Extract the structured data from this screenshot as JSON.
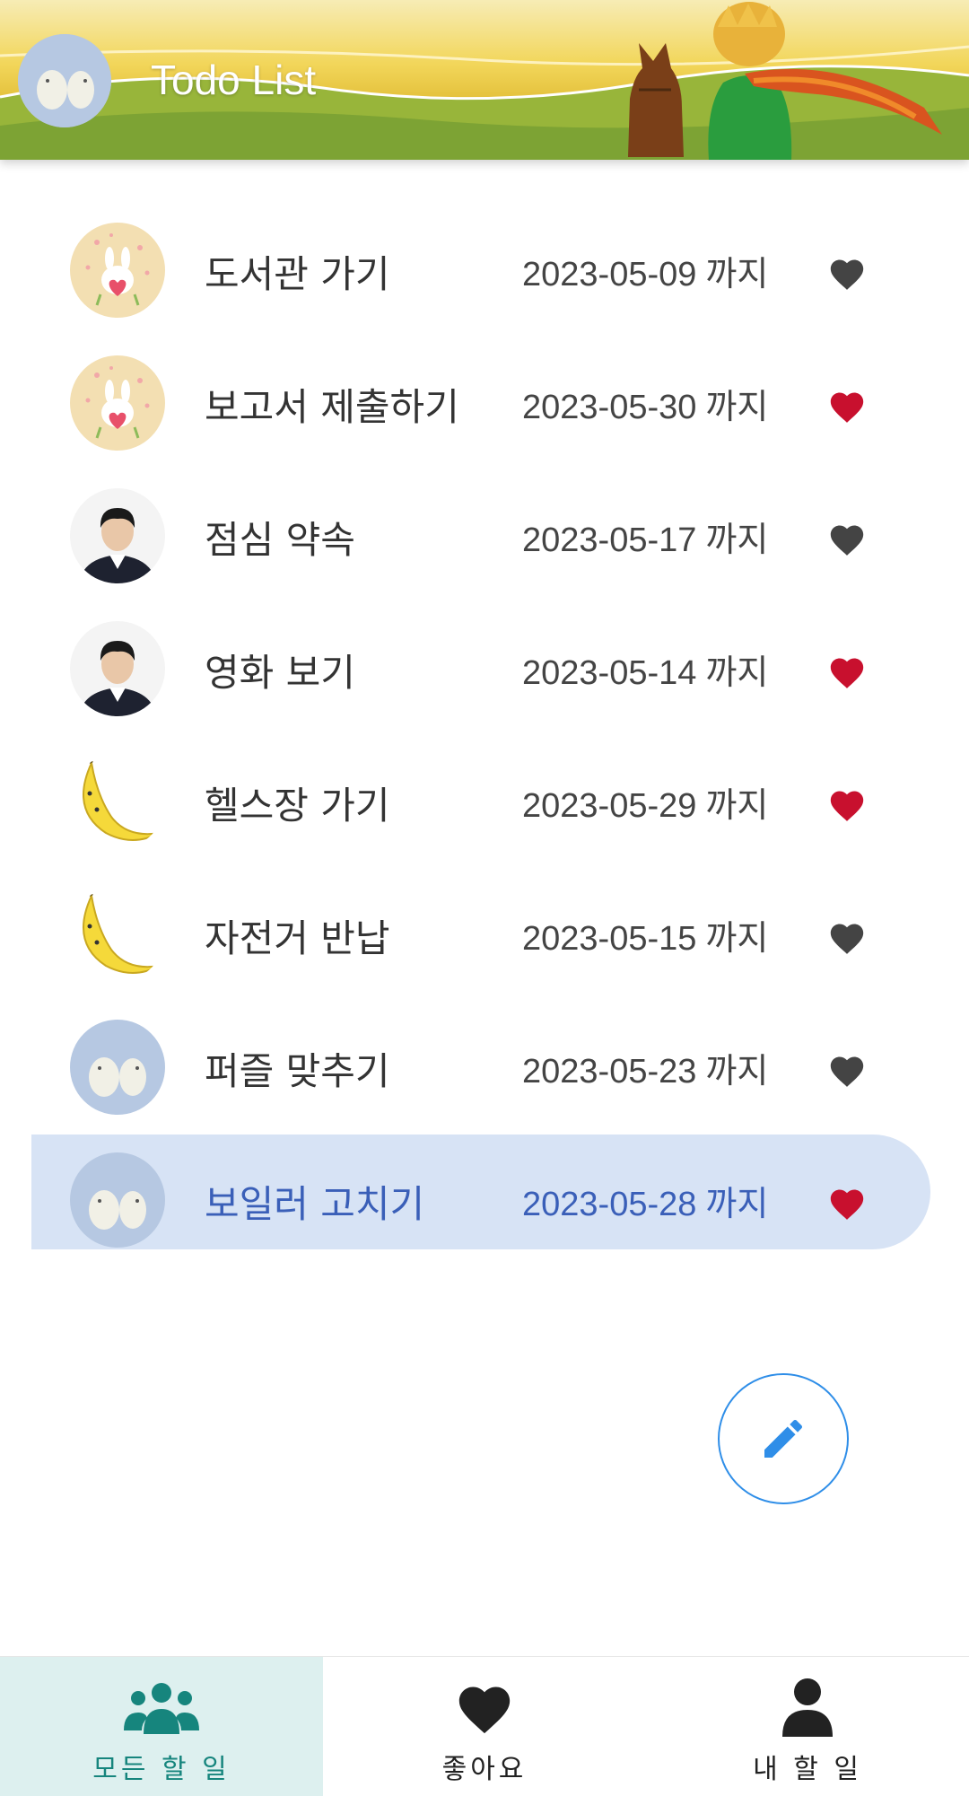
{
  "app": {
    "title": "Todo List",
    "accent_color": "#2f8ee8",
    "active_tab_color": "#16857d"
  },
  "todos": [
    {
      "title": "도서관 가기",
      "date": "2023-05-09",
      "suffix": "까지",
      "liked": false,
      "avatar": "bunny-avatar"
    },
    {
      "title": "보고서 제출하기",
      "date": "2023-05-30",
      "suffix": "까지",
      "liked": true,
      "avatar": "bunny-avatar"
    },
    {
      "title": "점심 약속",
      "date": "2023-05-17",
      "suffix": "까지",
      "liked": false,
      "avatar": "person-avatar"
    },
    {
      "title": "영화 보기",
      "date": "2023-05-14",
      "suffix": "까지",
      "liked": true,
      "avatar": "person-avatar"
    },
    {
      "title": "헬스장 가기",
      "date": "2023-05-29",
      "suffix": "까지",
      "liked": true,
      "avatar": "banana-avatar"
    },
    {
      "title": "자전거 반납",
      "date": "2023-05-15",
      "suffix": "까지",
      "liked": false,
      "avatar": "banana-avatar"
    },
    {
      "title": "퍼즐 맞추기",
      "date": "2023-05-23",
      "suffix": "까지",
      "liked": false,
      "avatar": "birds-avatar"
    },
    {
      "title": "보일러 고치기",
      "date": "2023-05-28",
      "suffix": "까지",
      "liked": true,
      "avatar": "birds-avatar",
      "selected": true
    }
  ],
  "heart_colors": {
    "liked": "#c8102e",
    "unliked": "#444444"
  },
  "fab": {
    "icon": "pencil-icon"
  },
  "bottom_nav": [
    {
      "label": "모든 할 일",
      "icon": "group-icon",
      "active": true
    },
    {
      "label": "좋아요",
      "icon": "heart-icon",
      "active": false
    },
    {
      "label": "내 할 일",
      "icon": "person-icon",
      "active": false
    }
  ]
}
